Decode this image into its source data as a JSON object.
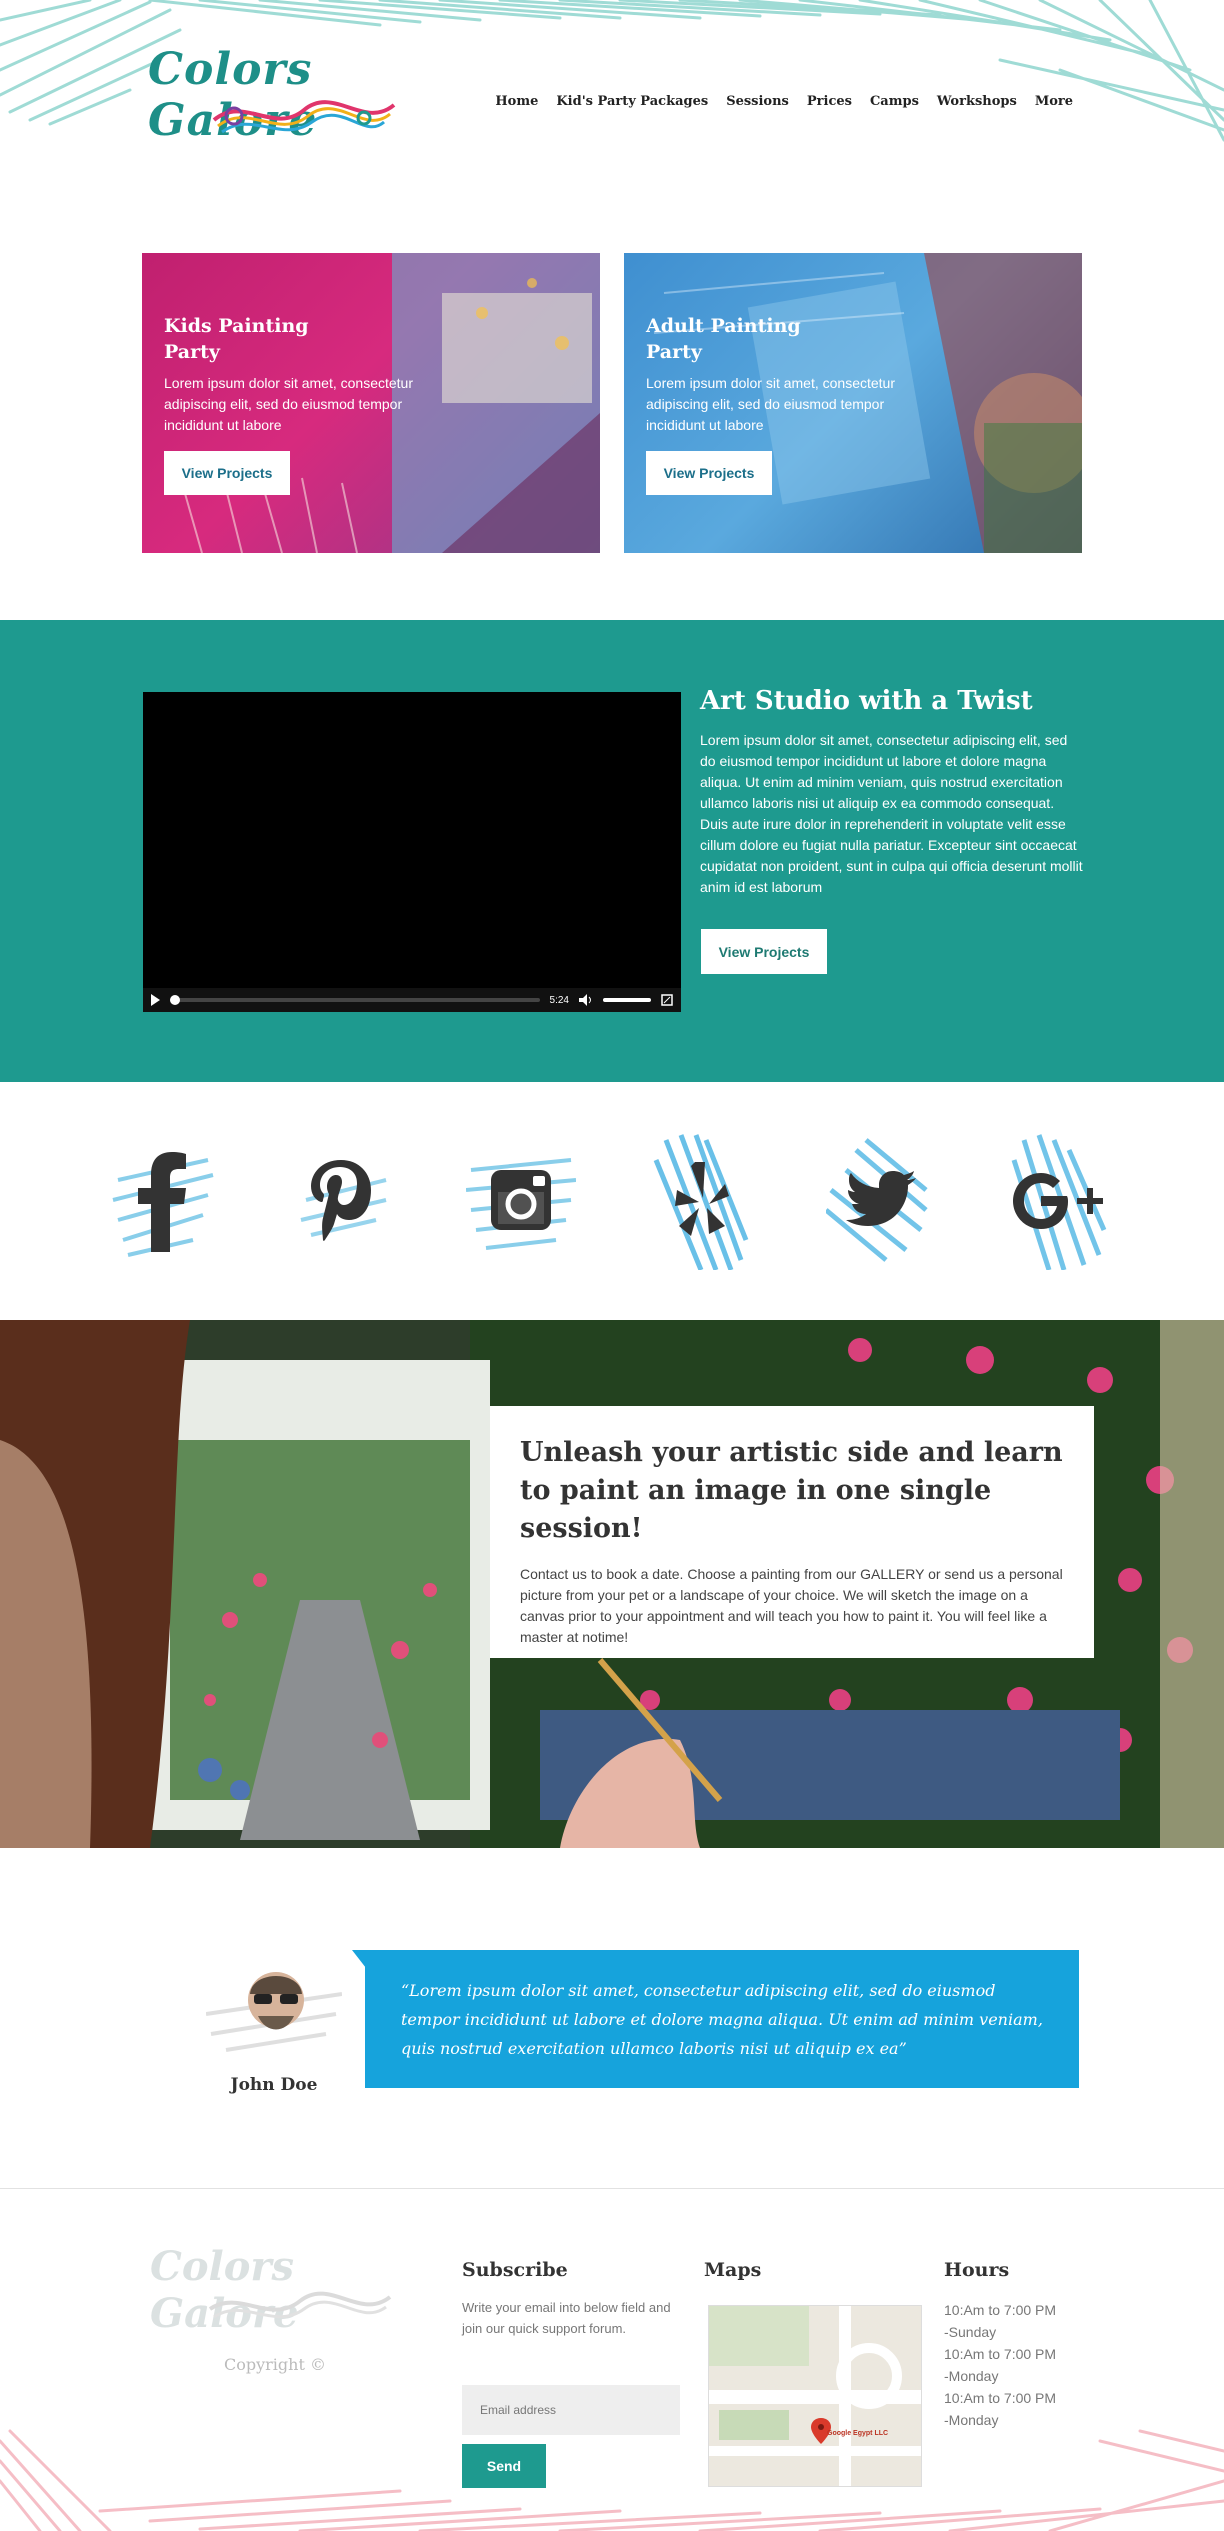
{
  "header": {
    "logo_text": "Colors Galore",
    "nav": [
      "Home",
      "Kid's Party Packages",
      "Sessions",
      "Prices",
      "Camps",
      "Workshops",
      "More"
    ],
    "active_nav": "Home"
  },
  "cards": [
    {
      "title": "Kids Painting Party",
      "text": "Lorem ipsum dolor sit amet, consectetur adipiscing elit, sed do eiusmod tempor incididunt ut labore",
      "button": "View Projects"
    },
    {
      "title": "Adult Painting Party",
      "text": "Lorem ipsum dolor sit amet, consectetur adipiscing elit, sed do eiusmod tempor incididunt ut labore",
      "button": "View Projects"
    }
  ],
  "studio": {
    "title": "Art Studio with a Twist",
    "text": "Lorem ipsum dolor sit amet, consectetur adipiscing elit, sed do eiusmod tempor incididunt ut labore et dolore magna aliqua. Ut enim ad minim veniam, quis nostrud exercitation ullamco laboris nisi ut aliquip ex ea commodo consequat. Duis aute irure dolor in reprehenderit in voluptate velit esse cillum dolore eu fugiat nulla pariatur. Excepteur sint occaecat cupidatat non proident, sunt in culpa qui officia deserunt mollit anim id est laborum",
    "button": "View Projects",
    "video_time": "5:24"
  },
  "social": [
    "facebook-icon",
    "pinterest-icon",
    "instagram-icon",
    "yelp-icon",
    "twitter-icon",
    "google-plus-icon"
  ],
  "session": {
    "title": "Unleash your artistic side and learn to paint an image in one single session!",
    "text": "Contact us to book a date. Choose a painting from our GALLERY or send us a personal picture from your pet or a landscape of your choice. We will sketch the image on a canvas prior to your appointment and will teach you how to paint it. You will feel like a master at notime!"
  },
  "testimonial": {
    "name": "John Doe",
    "quote": "“Lorem ipsum dolor sit amet, consectetur adipiscing elit, sed do eiusmod tempor incididunt ut labore et dolore magna aliqua. Ut enim ad minim veniam, quis nostrud exercitation ullamco laboris nisi ut aliquip ex ea”"
  },
  "footer": {
    "logo_text": "Colors Galore",
    "copyright": "Copyright ©",
    "subscribe_title": "Subscribe",
    "subscribe_text": "Write your email into below field and join our quick support forum.",
    "email_placeholder": "Email address",
    "send_label": "Send",
    "maps_title": "Maps",
    "map_label": "Google Egypt LLC",
    "hours_title": "Hours",
    "hours": [
      "10:Am  to 7:00 PM",
      "-Sunday",
      "10:Am  to 7:00 PM",
      "-Monday",
      "10:Am  to 7:00 PM",
      "-Monday"
    ]
  },
  "colors": {
    "teal": "#1e9a8f",
    "quote_blue": "#16a3dc",
    "crayon_top": "#7fcfc8",
    "crayon_bottom": "#f2a9b4"
  }
}
